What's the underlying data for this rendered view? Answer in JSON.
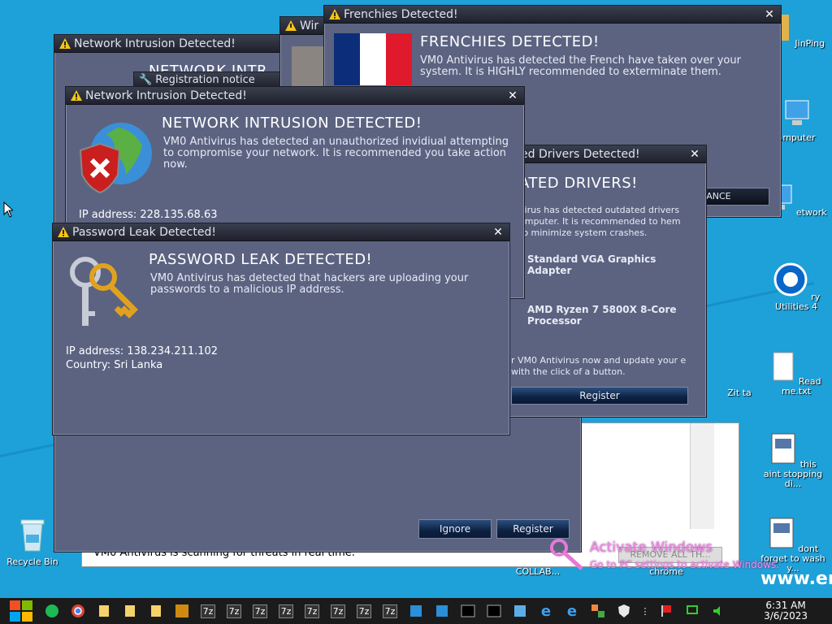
{
  "desktop": {
    "icons_left": [
      {
        "label": "Recycle Bin"
      }
    ],
    "icons_right": [
      {
        "label": "JinPing"
      },
      {
        "label": "omputer"
      },
      {
        "label": "etwork"
      },
      {
        "label": "ry Utilities 4"
      },
      {
        "label": "Read me.txt"
      },
      {
        "label": "Zit ta"
      },
      {
        "label": "this aint stopping di..."
      },
      {
        "label": "dont forget to wash y..."
      },
      {
        "label": "chrome"
      },
      {
        "label": "COLLAB..."
      }
    ],
    "watermark_title": "Activate Windows",
    "watermark_sub": "Go to PC settings to activate Windows.",
    "www_text": "www.er"
  },
  "background_window": {
    "status_text": "VM0 Antivirus is scanning for threats in real time.",
    "remove_label": "REMOVE ALL TH..."
  },
  "win_registration": {
    "title": "Registration notice"
  },
  "win_network_back": {
    "title": "Network Intrusion Detected!",
    "heading": "NETWORK INTR",
    "ignore_label": "Ignore",
    "register_label": "Register"
  },
  "win_cat": {
    "title": "Wir"
  },
  "win_frenchies": {
    "title": "Frenchies Detected!",
    "heading": "FRENCHIES DETECTED!",
    "body": "VM0 Antivirus has detected the French have taken over your system. It is HIGHLY recommended to exterminate them.",
    "button_label": "RANCE"
  },
  "win_drivers": {
    "title": "ed Drivers Detected!",
    "heading": "ATED DRIVERS!",
    "body": "virus has detected outdated drivers omputer. It is recommended to hem to minimize system crashes.",
    "driver1": "Standard VGA Graphics Adapter",
    "driver2": "AMD Ryzen 7 5800X 8-Core Processor",
    "footer": "r VM0 Antivirus now and update your e with the click of a button.",
    "register_label": "Register"
  },
  "win_network_front": {
    "title": "Network Intrusion Detected!",
    "heading": "NETWORK INTRUSION DETECTED!",
    "body": "VM0 Antivirus has detected an unauthorized invidiual attempting to compromise your network. It is recommended you take action now.",
    "ip": "IP address: 228.135.68.63"
  },
  "win_password": {
    "title": "Password Leak Detected!",
    "heading": "PASSWORD LEAK DETECTED!",
    "body": "VM0 Antivirus has detected that hackers are uploading your passwords to a malicious IP address.",
    "ip": "IP address: 138.234.211.102",
    "country": "Country: Sri Lanka"
  },
  "taskbar": {
    "items": [
      "7z",
      "7z",
      "7z",
      "7z",
      "7z",
      "7z",
      "7z",
      "7z"
    ],
    "time": "6:31 AM",
    "date": "3/6/2023"
  },
  "colors": {
    "desktop": "#1ea0d8",
    "window": "#5b6381",
    "titlebar": "#1f222c"
  }
}
